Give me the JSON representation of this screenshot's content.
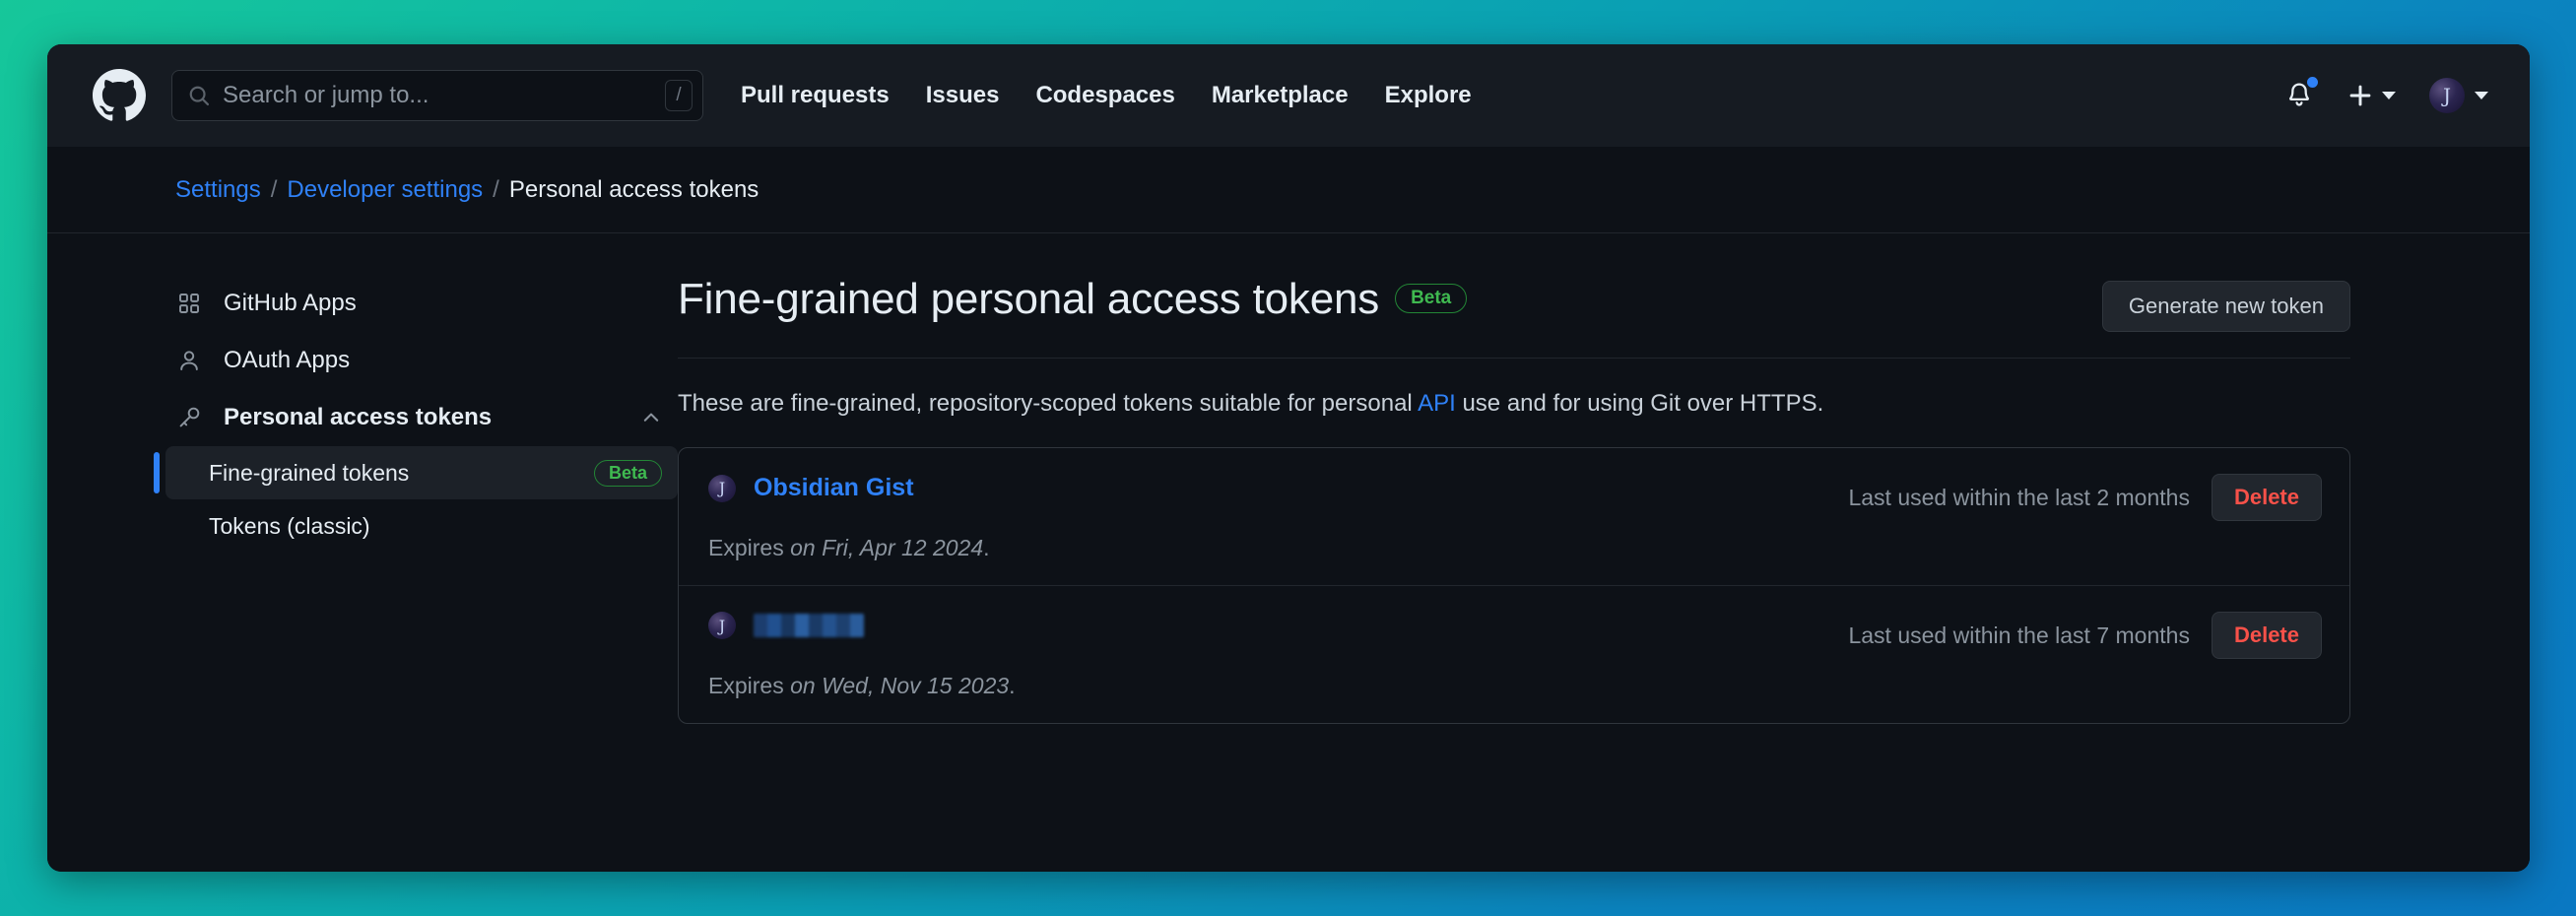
{
  "header": {
    "logo_icon": "github-mark-icon",
    "search": {
      "icon": "search-icon",
      "placeholder": "Search or jump to...",
      "value": "",
      "shortcut_key": "/"
    },
    "nav_links": [
      "Pull requests",
      "Issues",
      "Codespaces",
      "Marketplace",
      "Explore"
    ],
    "notifications": {
      "icon": "bell-icon",
      "has_unread_dot": true,
      "dot_color": "#2f81f7"
    },
    "create_menu": {
      "icon": "plus-icon",
      "caret": "chevron-down-icon"
    },
    "account_menu": {
      "icon": "avatar",
      "avatar_letter": "J",
      "caret": "chevron-down-icon"
    }
  },
  "breadcrumb": {
    "items": [
      {
        "label": "Settings",
        "is_link": true
      },
      {
        "label": "Developer settings",
        "is_link": true
      },
      {
        "label": "Personal access tokens",
        "is_link": false
      }
    ],
    "separator": "/"
  },
  "sidebar": {
    "items": [
      {
        "label": "GitHub Apps",
        "icon": "apps-grid-icon"
      },
      {
        "label": "OAuth Apps",
        "icon": "person-icon"
      },
      {
        "label": "Personal access tokens",
        "icon": "key-icon",
        "expanded": true,
        "chevron": "chevron-up-icon"
      }
    ],
    "sub_items": [
      {
        "label": "Fine-grained tokens",
        "badge": "Beta",
        "selected": true
      },
      {
        "label": "Tokens (classic)",
        "badge": "",
        "selected": false
      }
    ]
  },
  "main": {
    "title": "Fine-grained personal access tokens",
    "title_badge": "Beta",
    "generate_button": "Generate new token",
    "description_before": "These are fine-grained, repository-scoped tokens suitable for personal ",
    "description_link": "API",
    "description_after": " use and for using Git over HTTPS.",
    "tokens": [
      {
        "name": "Obsidian Gist",
        "redacted": false,
        "avatar_letter": "J",
        "last_used": "Last used within the last 2 months",
        "delete_label": "Delete",
        "expires_prefix": "Expires ",
        "expires_date": "on Fri, Apr 12 2024",
        "expires_suffix": "."
      },
      {
        "name": "",
        "redacted": true,
        "avatar_letter": "J",
        "last_used": "Last used within the last 7 months",
        "delete_label": "Delete",
        "expires_prefix": "Expires ",
        "expires_date": "on Wed, Nov 15 2023",
        "expires_suffix": "."
      }
    ]
  },
  "colors": {
    "accent_link": "#2f81f7",
    "danger": "#f85149",
    "success": "#3fb950",
    "canvas": "#0d1117",
    "header_bg": "#161b22",
    "border": "#30363d",
    "backdrop_start": "#16c79a",
    "backdrop_end": "#0a78c2"
  }
}
